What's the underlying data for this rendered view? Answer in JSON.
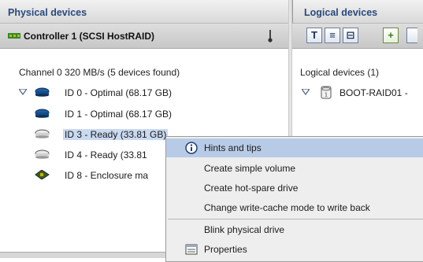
{
  "left": {
    "header": "Physical devices",
    "controller": "Controller 1 (SCSI HostRAID)",
    "channel": "Channel 0  320 MB/s (5 devices found)",
    "devices": [
      {
        "label": "ID 0 - Optimal (68.17 GB)",
        "expanded": true,
        "selected": false,
        "icon": "hard-drive-icon"
      },
      {
        "label": "ID 1 - Optimal (68.17 GB)",
        "selected": false,
        "icon": "hard-drive-icon"
      },
      {
        "label": "ID 3 - Ready (33.81 GB)",
        "selected": true,
        "icon": "hard-drive-outline-icon"
      },
      {
        "label": "ID 4 - Ready (33.81",
        "selected": false,
        "icon": "hard-drive-outline-icon"
      },
      {
        "label": "ID 8 - Enclosure ma",
        "selected": false,
        "icon": "enclosure-icon"
      }
    ]
  },
  "right": {
    "header": "Logical devices",
    "toolbar": [
      {
        "icon": "text-view-icon",
        "glyph": "T"
      },
      {
        "icon": "list-view-icon",
        "glyph": "≡"
      },
      {
        "icon": "tree-view-icon",
        "glyph": "⊟"
      },
      {
        "icon": "add-icon",
        "glyph": "+"
      }
    ],
    "summary": "Logical devices (1)",
    "logical": "BOOT-RAID01 -"
  },
  "context_menu": {
    "items": [
      {
        "label": "Hints and tips",
        "icon": "info-icon",
        "highlighted": true
      },
      {
        "label": "Create simple volume"
      },
      {
        "label": "Create hot-spare drive"
      },
      {
        "label": "Change write-cache mode to write back"
      },
      {
        "label": "Blink physical drive"
      },
      {
        "label": "Properties",
        "icon": "properties-icon"
      }
    ]
  },
  "colors": {
    "header_text": "#274a7c",
    "highlight": "#b8cbe6",
    "selection": "#c9d9f0"
  }
}
